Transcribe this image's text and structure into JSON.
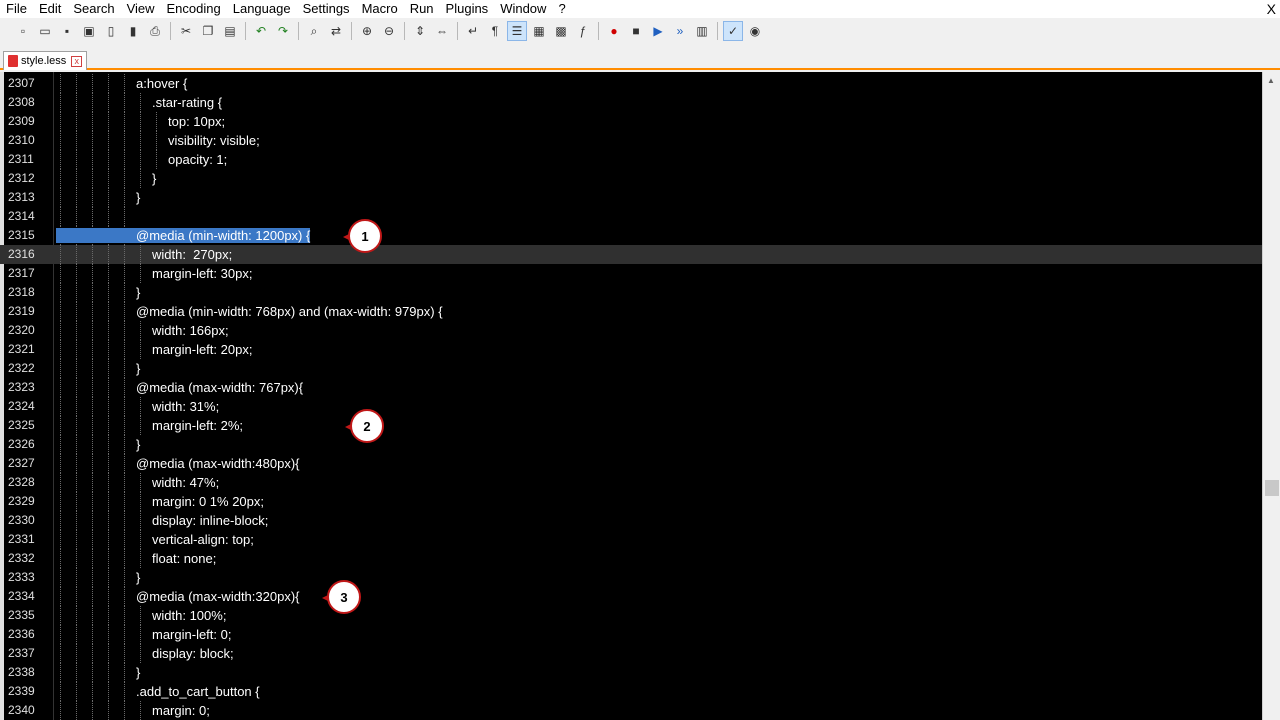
{
  "menu": [
    "File",
    "Edit",
    "Search",
    "View",
    "Encoding",
    "Language",
    "Settings",
    "Macro",
    "Run",
    "Plugins",
    "Window",
    "?"
  ],
  "menu_close": "X",
  "toolbar_icons": [
    "new-file-icon",
    "open-file-icon",
    "save-icon",
    "save-all-icon",
    "close-icon",
    "close-all-icon",
    "print-icon",
    "sep",
    "cut-icon",
    "copy-icon",
    "paste-icon",
    "sep",
    "undo-icon",
    "redo-icon",
    "sep",
    "find-icon",
    "replace-icon",
    "sep",
    "zoom-in-icon",
    "zoom-out-icon",
    "sep",
    "sync-vertical-icon",
    "sync-horizontal-icon",
    "sep",
    "word-wrap-icon",
    "show-all-chars-icon",
    "indent-guide-icon",
    "udl-icon",
    "doc-map-icon",
    "function-list-icon",
    "sep",
    "record-macro-icon",
    "stop-record-icon",
    "play-macro-icon",
    "run-macro-multiple-icon",
    "save-macro-icon",
    "sep",
    "spellcheck-icon",
    "monitoring-icon"
  ],
  "tab": {
    "filename": "style.less",
    "close": "x"
  },
  "lines": [
    {
      "n": "2307",
      "i": 5,
      "t": "a:hover {"
    },
    {
      "n": "2308",
      "i": 6,
      "t": ".star-rating {"
    },
    {
      "n": "2309",
      "i": 7,
      "t": "top: 10px;"
    },
    {
      "n": "2310",
      "i": 7,
      "t": "visibility: visible;"
    },
    {
      "n": "2311",
      "i": 7,
      "t": "opacity: 1;"
    },
    {
      "n": "2312",
      "i": 6,
      "t": "}"
    },
    {
      "n": "2313",
      "i": 5,
      "t": "}"
    },
    {
      "n": "2314",
      "i": 5,
      "t": ""
    },
    {
      "n": "2315",
      "i": 5,
      "t": "@media (min-width: 1200px) {",
      "selected": true
    },
    {
      "n": "2316",
      "i": 6,
      "t": "width:  270px;",
      "current": true
    },
    {
      "n": "2317",
      "i": 6,
      "t": "margin-left: 30px;"
    },
    {
      "n": "2318",
      "i": 5,
      "t": "}"
    },
    {
      "n": "2319",
      "i": 5,
      "t": "@media (min-width: 768px) and (max-width: 979px) {"
    },
    {
      "n": "2320",
      "i": 6,
      "t": "width: 166px;"
    },
    {
      "n": "2321",
      "i": 6,
      "t": "margin-left: 20px;"
    },
    {
      "n": "2322",
      "i": 5,
      "t": "}"
    },
    {
      "n": "2323",
      "i": 5,
      "t": "@media (max-width: 767px){"
    },
    {
      "n": "2324",
      "i": 6,
      "t": "width: 31%;"
    },
    {
      "n": "2325",
      "i": 6,
      "t": "margin-left: 2%;"
    },
    {
      "n": "2326",
      "i": 5,
      "t": "}"
    },
    {
      "n": "2327",
      "i": 5,
      "t": "@media (max-width:480px){"
    },
    {
      "n": "2328",
      "i": 6,
      "t": "width: 47%;"
    },
    {
      "n": "2329",
      "i": 6,
      "t": "margin: 0 1% 20px;"
    },
    {
      "n": "2330",
      "i": 6,
      "t": "display: inline-block;"
    },
    {
      "n": "2331",
      "i": 6,
      "t": "vertical-align: top;"
    },
    {
      "n": "2332",
      "i": 6,
      "t": "float: none;"
    },
    {
      "n": "2333",
      "i": 5,
      "t": "}"
    },
    {
      "n": "2334",
      "i": 5,
      "t": "@media (max-width:320px){"
    },
    {
      "n": "2335",
      "i": 6,
      "t": "width: 100%;"
    },
    {
      "n": "2336",
      "i": 6,
      "t": "margin-left: 0;"
    },
    {
      "n": "2337",
      "i": 6,
      "t": "display: block;"
    },
    {
      "n": "2338",
      "i": 5,
      "t": "}"
    },
    {
      "n": "2339",
      "i": 5,
      "t": ".add_to_cart_button {"
    },
    {
      "n": "2340",
      "i": 6,
      "t": "margin: 0;"
    }
  ],
  "callouts": [
    {
      "label": "1",
      "line": "2315"
    },
    {
      "label": "2",
      "line": "2325"
    },
    {
      "label": "3",
      "line": "2334"
    }
  ],
  "colors": {
    "selection": "#3b78c6",
    "current_line": "#303030",
    "tab_accent": "#ff8c00",
    "callout_border": "#c01818"
  }
}
